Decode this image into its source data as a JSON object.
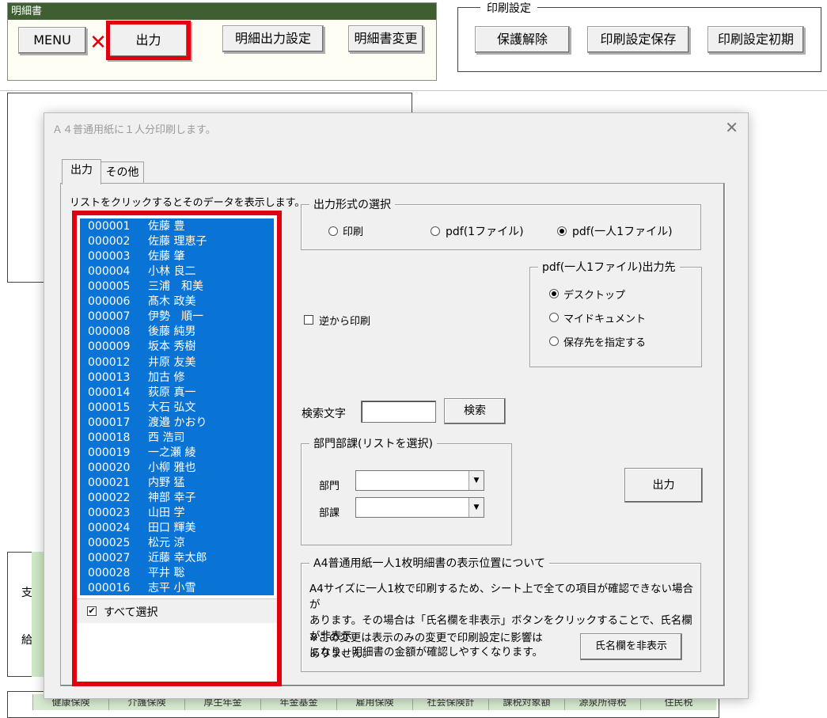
{
  "sheet": {
    "meisai_title": "明細書",
    "menu_label": "MENU",
    "output_label": "出力",
    "meisai_setting_label": "明細出力設定",
    "meisai_change_label": "明細書変更",
    "print_group_title": "印刷設定",
    "unprotect_label": "保護解除",
    "save_print_label": "印刷設定保存",
    "init_print_label": "印刷設定初期",
    "side_char_1": "支",
    "side_char_2": "給",
    "table_headers": [
      "健康保険",
      "介護保険",
      "厚生年金",
      "年金基金",
      "雇用保険",
      "社会保険計",
      "課税対象額",
      "源泉所得税",
      "住民税"
    ]
  },
  "dialog": {
    "title": "Ａ４普通用紙に１人分印刷します。",
    "close_glyph": "✕",
    "tabs": [
      {
        "label": "出力"
      },
      {
        "label": "その他"
      }
    ],
    "list_hint": "リストをクリックするとそのデータを表示します。",
    "employees": [
      {
        "code": "000001",
        "name": "佐藤 豊"
      },
      {
        "code": "000002",
        "name": "佐藤 理恵子"
      },
      {
        "code": "000003",
        "name": "佐藤 肇"
      },
      {
        "code": "000004",
        "name": "小林 良二"
      },
      {
        "code": "000005",
        "name": "三浦　和美"
      },
      {
        "code": "000006",
        "name": "髙木 政美"
      },
      {
        "code": "000007",
        "name": "伊勢　順一"
      },
      {
        "code": "000008",
        "name": "後藤 純男"
      },
      {
        "code": "000009",
        "name": "坂本 秀樹"
      },
      {
        "code": "000012",
        "name": "井原 友美"
      },
      {
        "code": "000013",
        "name": "加古 修"
      },
      {
        "code": "000014",
        "name": "荻原 真一"
      },
      {
        "code": "000015",
        "name": "大石 弘文"
      },
      {
        "code": "000017",
        "name": "渡邉 かおり"
      },
      {
        "code": "000018",
        "name": "西 浩司"
      },
      {
        "code": "000019",
        "name": "一之瀬 綾"
      },
      {
        "code": "000020",
        "name": "小柳 雅也"
      },
      {
        "code": "000021",
        "name": "内野 猛"
      },
      {
        "code": "000022",
        "name": "神部 幸子"
      },
      {
        "code": "000023",
        "name": "山田 学"
      },
      {
        "code": "000024",
        "name": "田口 輝美"
      },
      {
        "code": "000025",
        "name": "松元 涼"
      },
      {
        "code": "000027",
        "name": "近藤 幸太郎"
      },
      {
        "code": "000028",
        "name": "平井 聡"
      },
      {
        "code": "000016",
        "name": "志平 小雪"
      }
    ],
    "select_all_label": "すべて選択",
    "select_all_checked": true,
    "format_group_title": "出力形式の選択",
    "format_options": [
      {
        "label": "印刷",
        "selected": false
      },
      {
        "label": "pdf(1ファイル)",
        "selected": false
      },
      {
        "label": "pdf(一人1ファイル)",
        "selected": true
      }
    ],
    "reverse_print_label": "逆から印刷",
    "reverse_print_checked": false,
    "dest_group_title": "pdf(一人1ファイル)出力先",
    "dest_options": [
      {
        "label": "デスクトップ",
        "selected": true
      },
      {
        "label": "マイドキュメント",
        "selected": false
      },
      {
        "label": "保存先を指定する",
        "selected": false
      }
    ],
    "search_label": "検索文字",
    "search_value": "",
    "search_button": "検索",
    "dept_group_title": "部門部課(リストを選択)",
    "dept_label": "部門",
    "dept_value": "",
    "section_label": "部課",
    "section_value": "",
    "output_button": "出力",
    "a4_group_title": "A4普通用紙一人1枚明細書の表示位置について",
    "a4_note_lines": [
      "A4サイズに一人1枚で印刷するため、シート上で全ての項目が確認できない場合が",
      "あります。その場合は「氏名欄を非表示」ボタンをクリックすることで、氏名欄が非表示",
      "になり、明細書の金額が確認しやすくなります。"
    ],
    "a4_note2_lines": [
      "※この変更は表示のみの変更で印刷設定に影響は",
      "ありません。"
    ],
    "hide_name_button": "氏名欄を非表示"
  }
}
